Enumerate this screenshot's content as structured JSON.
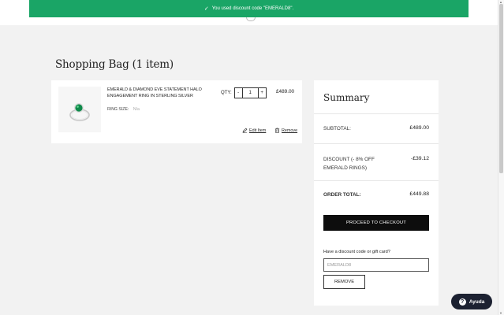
{
  "toast": {
    "message": "You used discount code \"EMERALD8\".",
    "icon": "check-icon"
  },
  "page": {
    "title": "Shopping Bag (1 item)"
  },
  "item": {
    "name": "EMERALD & DIAMOND EVE STATEMENT HALO ENGAGEMENT RING IN STERLING SILVER",
    "ring_size_label": "RING SIZE:",
    "ring_size_value": "N/a",
    "qty_label": "QTY:",
    "qty_minus": "-",
    "qty_value": "1",
    "qty_plus": "+",
    "price": "£489.00",
    "edit_label": "Edit Item",
    "remove_label": "Remove"
  },
  "summary": {
    "title": "Summary",
    "subtotal_label": "SUBTOTAL:",
    "subtotal_value": "£489.00",
    "discount_label": "DISCOUNT (- 8% OFF EMERALD RINGS)",
    "discount_value": "-£39.12",
    "order_total_label": "ORDER TOTAL:",
    "order_total_value": "£449.88",
    "checkout_label": "PROCEED TO CHECKOUT",
    "promo_label": "Have a discount code or gift card?",
    "promo_value": "EMERALD8",
    "remove_code_label": "REMOVE"
  },
  "help": {
    "label": "Ayuda",
    "icon": "question-icon"
  },
  "colors": {
    "toast_bg": "#1aa566",
    "button_dark": "#0d0d0d",
    "help_bg": "#1c2131",
    "emerald": "#0f8a4a"
  }
}
